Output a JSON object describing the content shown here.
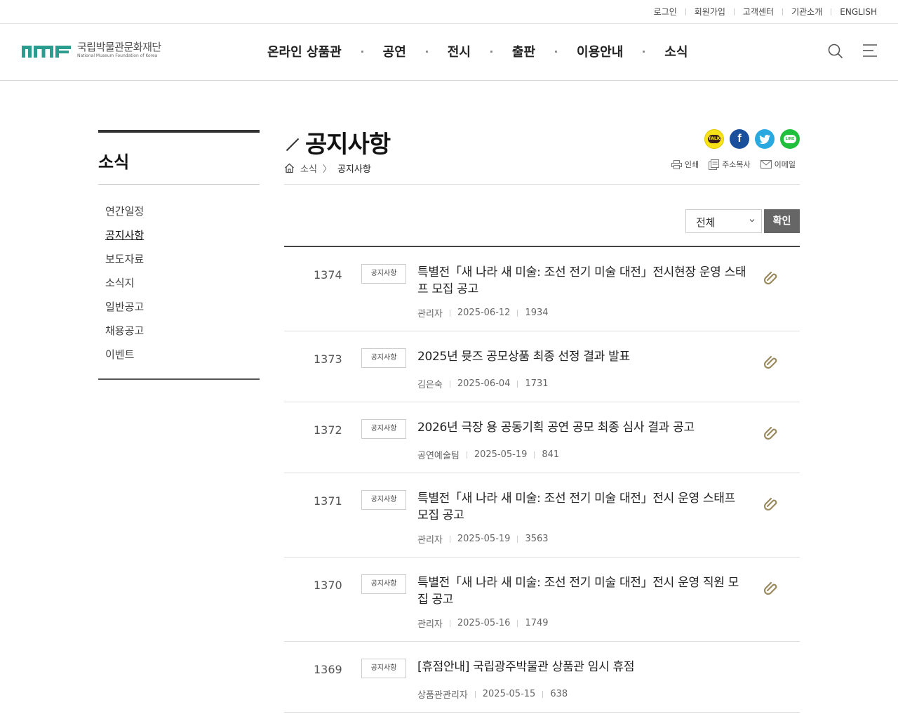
{
  "util_links": [
    "로그인",
    "회원가입",
    "고객센터",
    "기관소개",
    "ENGLISH"
  ],
  "logo": {
    "ko": "국립박물관문화재단",
    "en": "National Museum Foundation of Korea",
    "mark": "nmf"
  },
  "gnb": [
    "온라인 상품관",
    "공연",
    "전시",
    "출판",
    "이용안내",
    "소식"
  ],
  "header_icons": {
    "search": "search-icon",
    "menu": "menu-icon"
  },
  "sidebar": {
    "title": "소식",
    "items": [
      {
        "label": "연간일정",
        "active": false
      },
      {
        "label": "공지사항",
        "active": true
      },
      {
        "label": "보도자료",
        "active": false
      },
      {
        "label": "소식지",
        "active": false
      },
      {
        "label": "일반공고",
        "active": false
      },
      {
        "label": "채용공고",
        "active": false
      },
      {
        "label": "이벤트",
        "active": false
      }
    ]
  },
  "page": {
    "title": "공지사항",
    "breadcrumb": [
      "소식",
      "공지사항"
    ],
    "share": [
      {
        "name": "kakaotalk",
        "label": "TALK",
        "color": "#f7e317"
      },
      {
        "name": "facebook",
        "label": "f",
        "color": "#1a4f9c"
      },
      {
        "name": "twitter",
        "label": "t",
        "color": "#2aa9e0"
      },
      {
        "name": "line",
        "label": "LINE",
        "color": "#20c03c"
      }
    ],
    "tools": [
      "인쇄",
      "주소복사",
      "이메일"
    ]
  },
  "filter": {
    "selected": "전체",
    "button": "확인"
  },
  "posts": [
    {
      "num": "1374",
      "category": "공지사항",
      "title": "특별전「새 나라 새 미술: 조선 전기 미술 대전」전시현장 운영 스태프 모집 공고",
      "author": "관리자",
      "date": "2025-06-12",
      "views": "1934"
    },
    {
      "num": "1373",
      "category": "공지사항",
      "title": "2025년 뮷즈 공모상품 최종 선정 결과 발표",
      "author": "김은숙",
      "date": "2025-06-04",
      "views": "1731"
    },
    {
      "num": "1372",
      "category": "공지사항",
      "title": "2026년 극장 용 공동기획 공연 공모 최종 심사 결과 공고",
      "author": "공연예술팀",
      "date": "2025-05-19",
      "views": "841"
    },
    {
      "num": "1371",
      "category": "공지사항",
      "title": "특별전「새 나라 새 미술: 조선 전기 미술 대전」전시 운영 스태프 모집 공고",
      "author": "관리자",
      "date": "2025-05-19",
      "views": "3563"
    },
    {
      "num": "1370",
      "category": "공지사항",
      "title": "특별전「새 나라 새 미술: 조선 전기 미술 대전」전시 운영 직원 모집 공고",
      "author": "관리자",
      "date": "2025-05-16",
      "views": "1749"
    },
    {
      "num": "1369",
      "category": "공지사항",
      "title": "[휴점안내] 국립광주박물관 상품관 임시 휴점",
      "author": "상품관관리자",
      "date": "2025-05-15",
      "views": "638"
    }
  ]
}
